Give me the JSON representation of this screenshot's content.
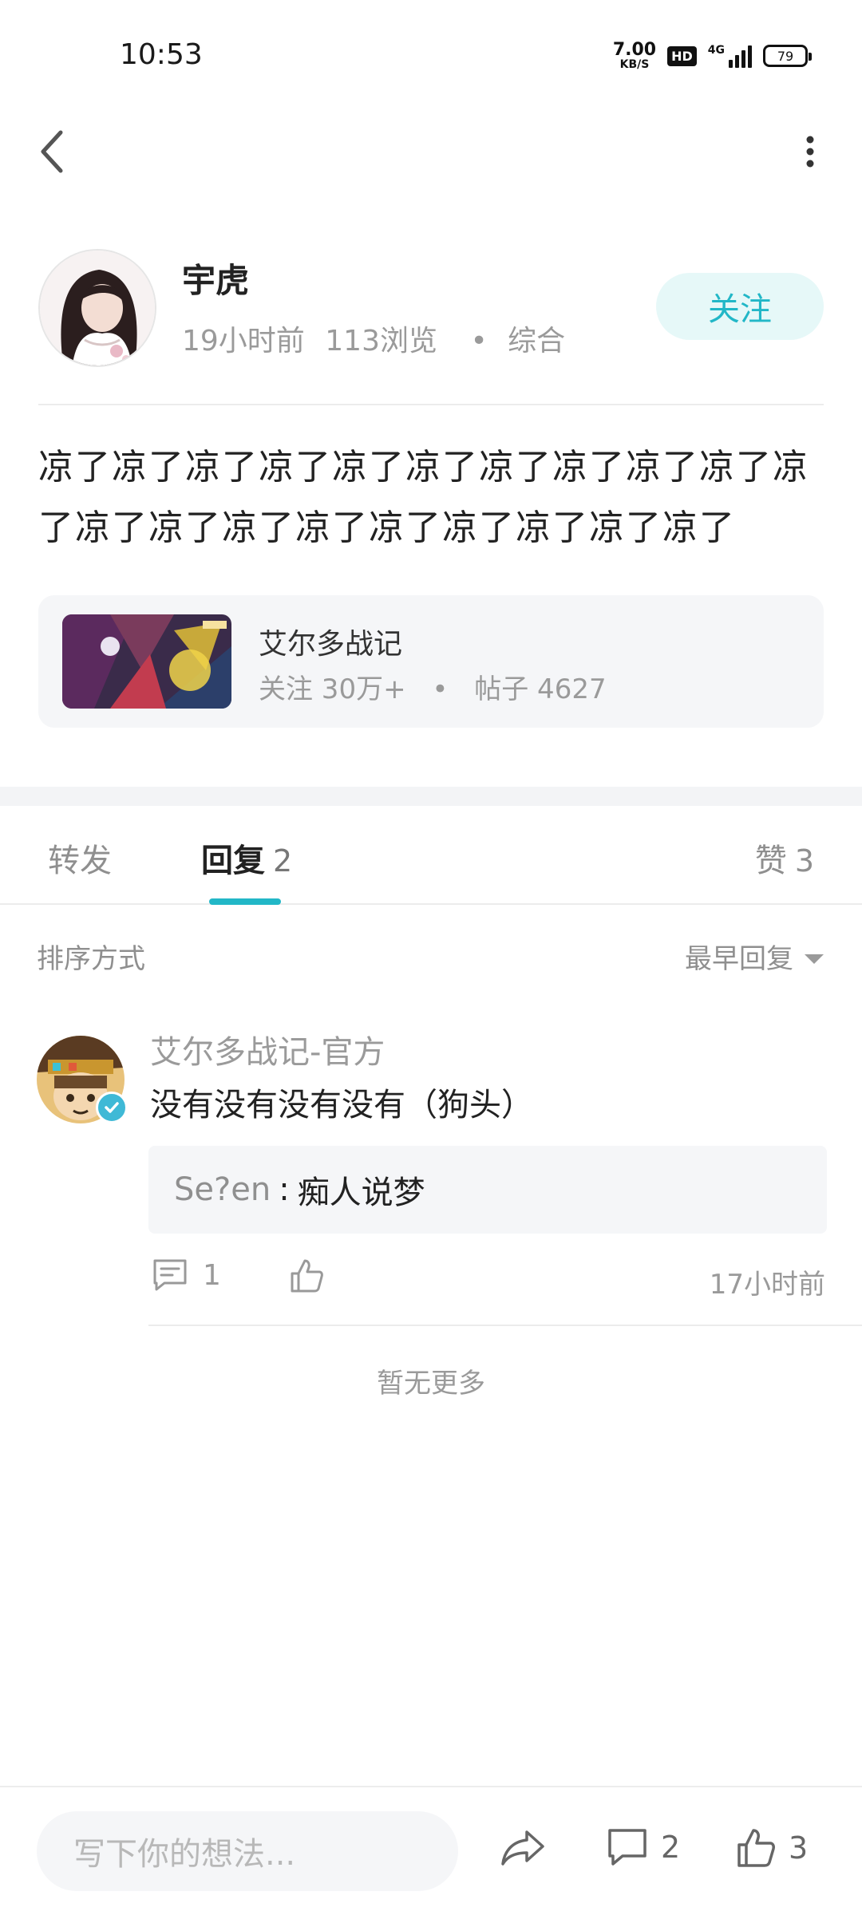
{
  "status_bar": {
    "time": "10:53",
    "net_speed": "7.00",
    "net_unit": "KB/S",
    "hd": "HD",
    "network": "4G",
    "battery": "79"
  },
  "author": {
    "name": "宇虎",
    "time_ago": "19小时前",
    "views": "113浏览",
    "dot": "•",
    "category": "综合",
    "follow_label": "关注"
  },
  "post": {
    "text": "凉了凉了凉了凉了凉了凉了凉了凉了凉了凉了凉了凉了凉了凉了凉了凉了凉了凉了凉了凉了"
  },
  "game_card": {
    "name": "艾尔多战记",
    "followers": "关注 30万+",
    "dot": "•",
    "posts": "帖子 4627"
  },
  "tabs": {
    "forward": "转发",
    "reply": "回复",
    "reply_count": "2",
    "like": "赞",
    "like_count": "3"
  },
  "sort": {
    "label": "排序方式",
    "selected": "最早回复"
  },
  "comment": {
    "user": "艾尔多战记-官方",
    "text": "没有没有没有没有（狗头）",
    "quote_user": "Se?en",
    "quote_sep": ":",
    "quote_text": "痴人说梦",
    "reply_count": "1",
    "time": "17小时前"
  },
  "no_more": "暂无更多",
  "bottom_bar": {
    "input_placeholder": "写下你的想法...",
    "comment_count": "2",
    "like_count": "3"
  },
  "colors": {
    "accent": "#22b7c7",
    "follow_bg": "#e6f8f8",
    "muted": "#9a9a9a",
    "card_bg": "#f5f6f8"
  },
  "icons": [
    "back-icon",
    "more-icon",
    "reply-icon",
    "thumb-up-icon",
    "share-icon",
    "comment-icon",
    "verified-icon",
    "sort-caret-icon"
  ]
}
